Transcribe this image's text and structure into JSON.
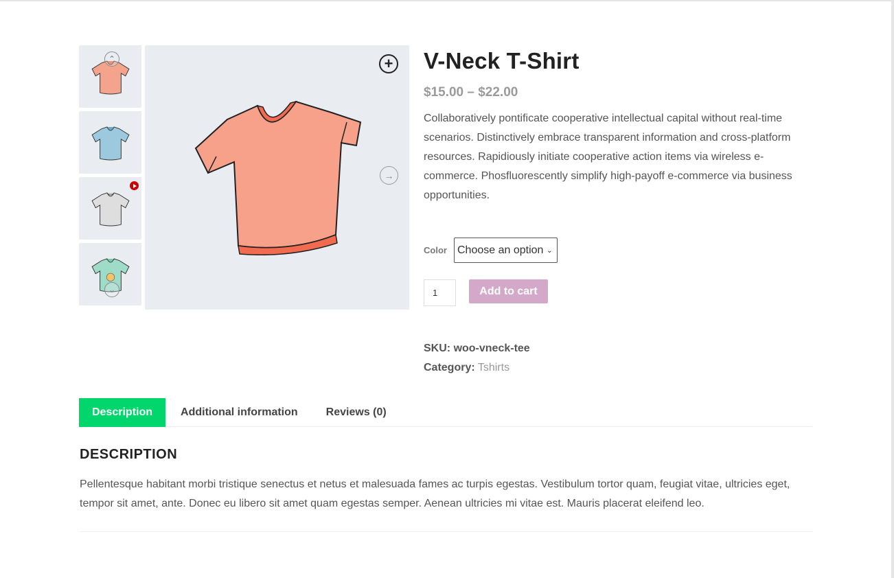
{
  "product": {
    "title": "V-Neck T-Shirt",
    "price": "$15.00 – $22.00",
    "short_description": "Collaboratively pontificate cooperative intellectual capital without real-time scenarios. Distinctively embrace transparent information and cross-platform resources. Rapidiously initiate cooperative action items via wireless e-commerce. Phosfluorescently simplify high-payoff e-commerce via business opportunities.",
    "color_label": "Color",
    "color_select": "Choose an option",
    "quantity": "1",
    "add_to_cart": "Add to cart",
    "sku_label": "SKU:",
    "sku_value": "woo-vneck-tee",
    "category_label": "Category:",
    "category_value": "Tshirts"
  },
  "gallery": {
    "thumbnails": [
      {
        "color": "#f4a48c",
        "name": "pink"
      },
      {
        "color": "#9cc9de",
        "name": "blue"
      },
      {
        "color": "#dedede",
        "name": "gray",
        "video": true
      },
      {
        "color": "#9fdcc8",
        "name": "green",
        "badge": true
      }
    ],
    "main_color": "#f7a08a",
    "icons": [
      "chevron-up-icon",
      "chevron-down-icon",
      "zoom-in-icon",
      "arrow-right-icon",
      "play-icon"
    ]
  },
  "tabs": [
    {
      "label": "Description",
      "active": true
    },
    {
      "label": "Additional information",
      "active": false
    },
    {
      "label": "Reviews (0)",
      "active": false
    }
  ],
  "description": {
    "heading": "DESCRIPTION",
    "text": "Pellentesque habitant morbi tristique senectus et netus et malesuada fames ac turpis egestas. Vestibulum tortor quam, feugiat vitae, ultricies eget, tempor sit amet, ante. Donec eu libero sit amet quam egestas semper. Aenean ultricies mi vitae est. Mauris placerat eleifend leo."
  },
  "colors": {
    "accent_tab": "#00d66b",
    "add_to_cart_bg": "#d3a8c9",
    "image_bg": "#e9edf2"
  }
}
